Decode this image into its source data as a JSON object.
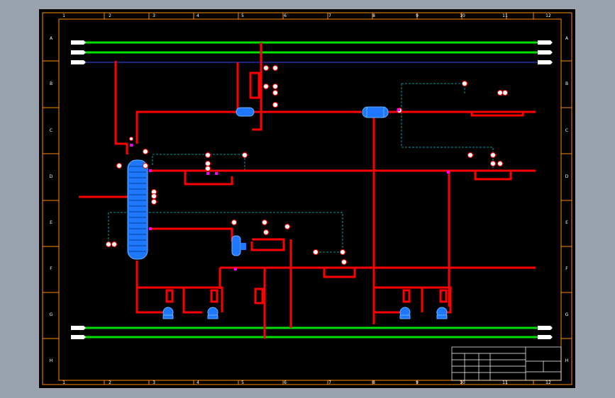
{
  "drawing": {
    "columns": [
      "1",
      "2",
      "3",
      "4",
      "5",
      "6",
      "7",
      "8",
      "9",
      "10",
      "11",
      "12"
    ],
    "rows": [
      "A",
      "B",
      "C",
      "D",
      "E",
      "F",
      "G",
      "H"
    ]
  },
  "colors": {
    "background": "#000000",
    "frame": "#ff8c00",
    "process_line": "#ff0000",
    "utility_line": "#00e000",
    "vessel": "#1e78ff",
    "signal_line": "#00c8c8",
    "instrument": "#ff0000",
    "tag": "#ffffff"
  }
}
